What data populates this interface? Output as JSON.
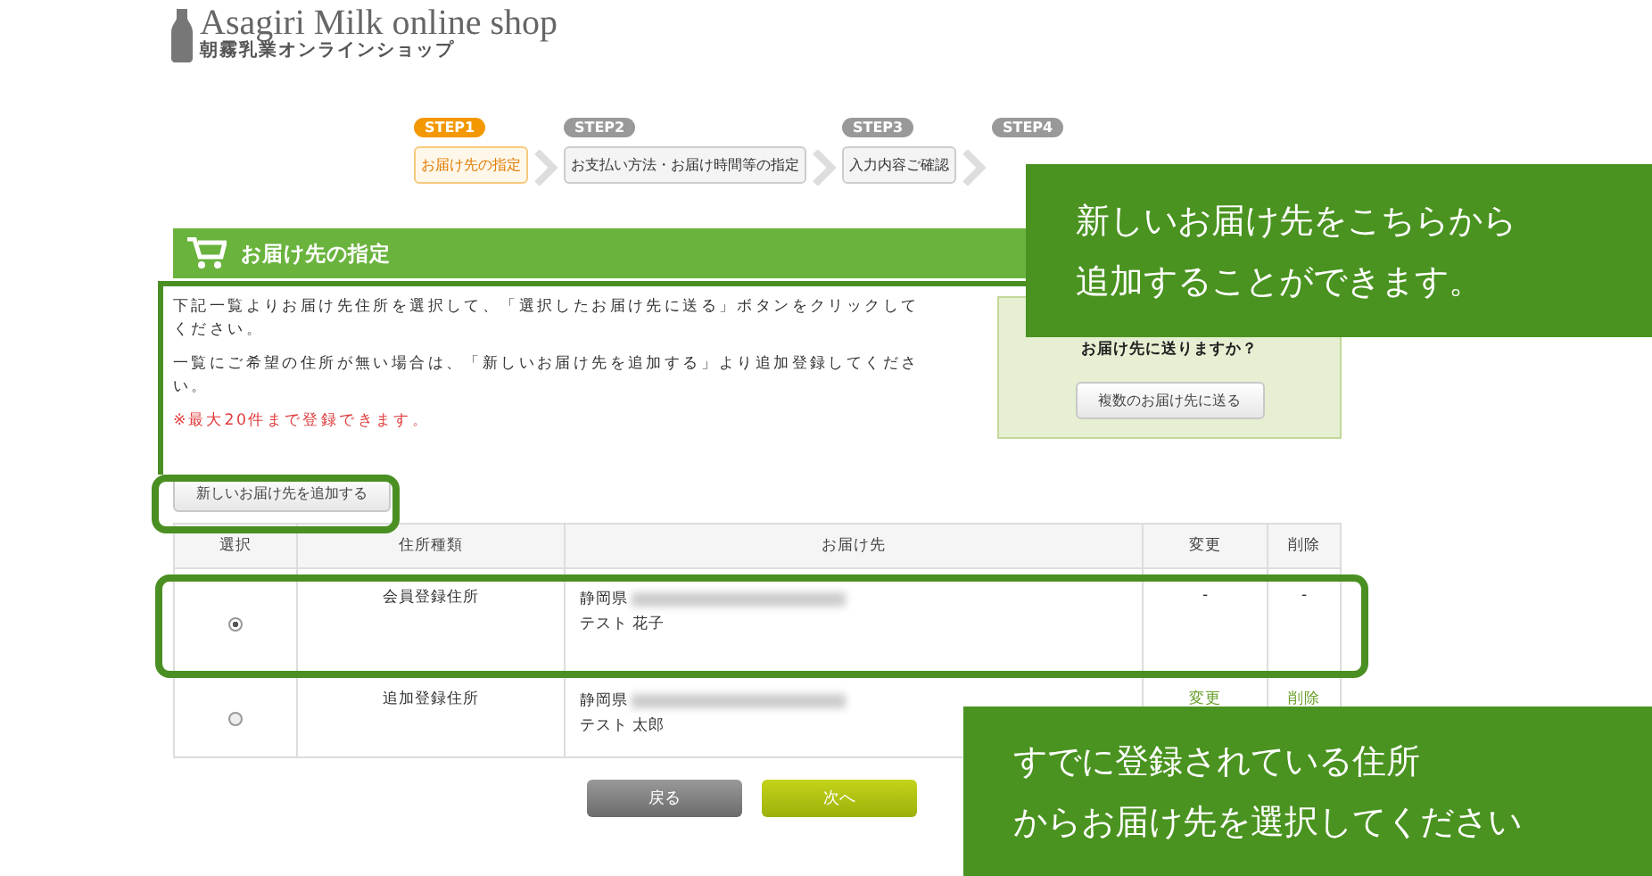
{
  "logo": {
    "title": "Asagiri Milk online shop",
    "subtitle": "朝霧乳業オンラインショップ"
  },
  "steps": [
    {
      "badge": "STEP1",
      "label": "お届け先の指定",
      "selected": true
    },
    {
      "badge": "STEP2",
      "label": "お支払い方法・お届け時間等の指定",
      "selected": false
    },
    {
      "badge": "STEP3",
      "label": "入力内容ご確認",
      "selected": false
    },
    {
      "badge": "STEP4",
      "selected": false
    }
  ],
  "section": {
    "title": "お届け先の指定"
  },
  "instructions": [
    "下記一覧よりお届け先住所を選択して、「選択したお届け先に送る」ボタンをクリックしてください。",
    "一覧にご希望の住所が無い場合は、「新しいお届け先を追加する」より追加登録してください。"
  ],
  "note": "※最大20件まで登録できます。",
  "add_button": "新しいお届け先を追加する",
  "multi_panel": {
    "question": "お届け先に送りますか？",
    "button": "複数のお届け先に送る"
  },
  "table": {
    "columns": [
      "選択",
      "住所種類",
      "お届け先",
      "変更",
      "削除"
    ],
    "rows": [
      {
        "selected": true,
        "type": "会員登録住所",
        "prefecture": "静岡県",
        "name": "テスト 花子",
        "edit": "-",
        "delete": "-",
        "linked": false
      },
      {
        "selected": false,
        "type": "追加登録住所",
        "prefecture": "静岡県",
        "name": "テスト 太郎",
        "edit": "変更",
        "delete": "削除",
        "linked": true
      }
    ]
  },
  "buttons": {
    "back": "戻る",
    "next": "次へ"
  },
  "callouts": [
    {
      "lines": [
        "新しいお届け先をこちらから",
        "追加することができます。"
      ]
    },
    {
      "lines": [
        "すでに登録されている住所",
        "からお届け先を選択してください"
      ]
    }
  ]
}
